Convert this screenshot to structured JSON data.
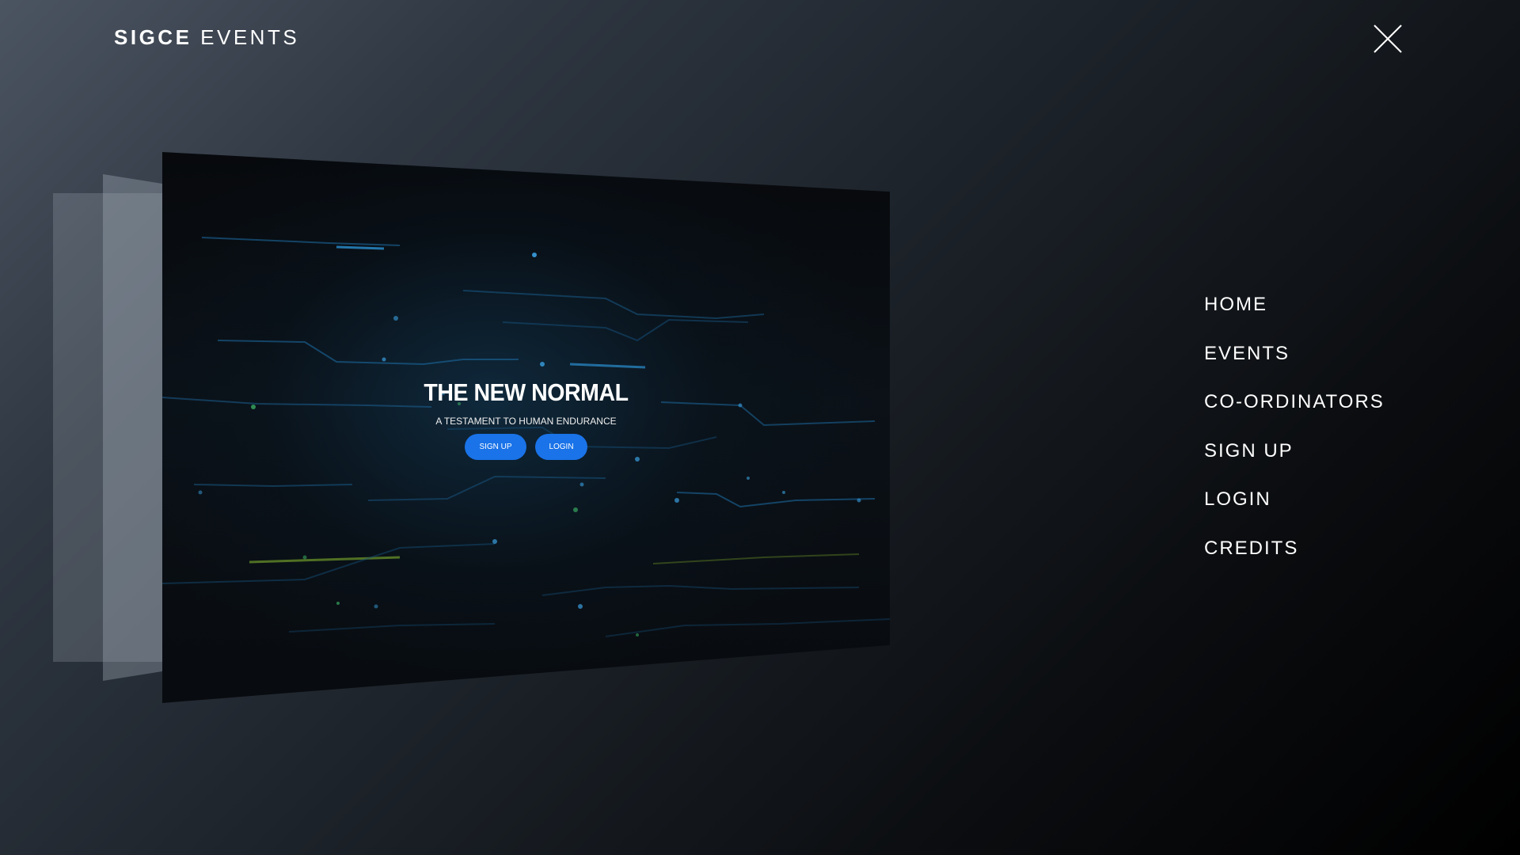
{
  "header": {
    "brand_bold": "SIGCE",
    "brand_light": "EVENTS",
    "close_icon": "close-icon"
  },
  "preview": {
    "title": "THE NEW NORMAL",
    "subtitle": "A TESTAMENT TO HUMAN ENDURANCE",
    "signup_label": "SIGN UP",
    "login_label": "LOGIN",
    "button_color": "#1a73e8",
    "background_motif": "circuit-lines"
  },
  "nav": {
    "items": [
      {
        "label": "HOME"
      },
      {
        "label": "EVENTS"
      },
      {
        "label": "CO-ORDINATORS"
      },
      {
        "label": "SIGN UP"
      },
      {
        "label": "LOGIN"
      },
      {
        "label": "CREDITS"
      }
    ]
  },
  "colors": {
    "text": "#ffffff",
    "accent": "#1a73e8",
    "circuit": "#1f7fb8"
  }
}
